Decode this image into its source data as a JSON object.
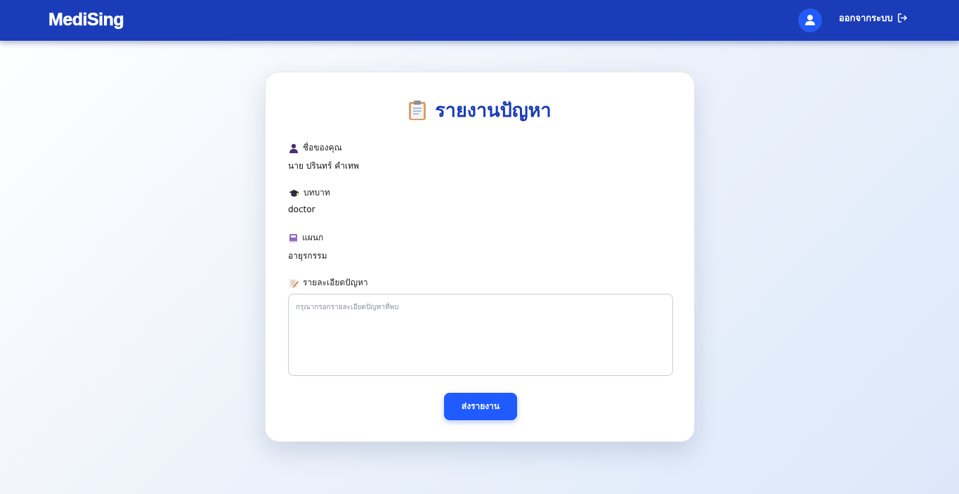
{
  "header": {
    "logo": "MediSing",
    "logout_label": "ออกจากระบบ",
    "bg_color": "#1a3cb8"
  },
  "form": {
    "title": "รายงานปัญหา",
    "name_label": "ชื่อของคุณ",
    "name_value": "นาย ปรินทร์ คำเทพ",
    "role_label": "บทบาท",
    "role_value": "doctor",
    "department_label": "แผนก",
    "department_value": "อายุรกรรม",
    "detail_label": "รายละเอียดปัญหา",
    "detail_placeholder": "กรุณากรอกรายละเอียดปัญหาที่พบ",
    "submit_label": "ส่งรายงาน",
    "accent_color": "#1f5bff"
  },
  "icons": {
    "avatar": "user-icon",
    "logout": "logout-icon",
    "title": "clipboard-icon",
    "name": "person-icon",
    "role": "graduation-cap-icon",
    "department": "book-icon",
    "detail": "memo-icon"
  }
}
